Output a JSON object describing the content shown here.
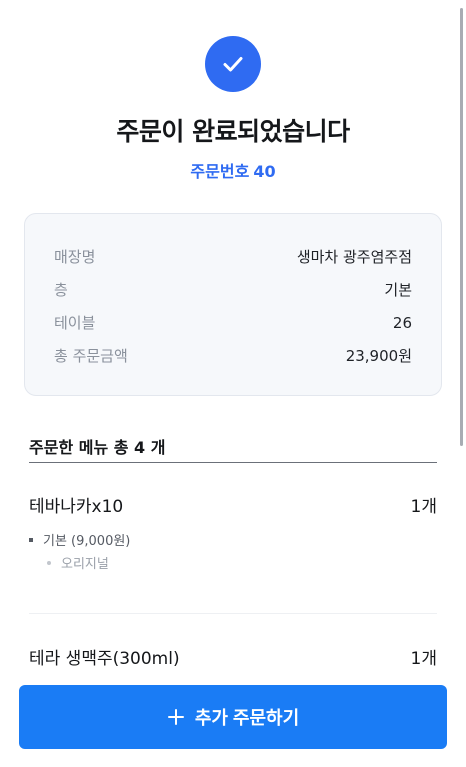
{
  "header": {
    "title": "주문이 완료되었습니다",
    "order_number_label": "주문번호",
    "order_number": "40"
  },
  "info": {
    "rows": [
      {
        "label": "매장명",
        "value": "생마차 광주염주점"
      },
      {
        "label": "층",
        "value": "기본"
      },
      {
        "label": "테이블",
        "value": "26"
      },
      {
        "label": "총 주문금액",
        "value": "23,900원"
      }
    ]
  },
  "menu": {
    "title": "주문한 메뉴 총 4 개",
    "items": [
      {
        "name": "테바나카x10",
        "qty": "1개",
        "option": "기본 (9,000원)",
        "sub_option": "오리지널"
      },
      {
        "name": "테라 생맥주(300ml)",
        "qty": "1개"
      }
    ]
  },
  "actions": {
    "add_order_label": "추가 주문하기"
  },
  "colors": {
    "accent": "#2f6bf2",
    "button": "#1a7cf5"
  },
  "icons": {
    "success": "check-icon",
    "add": "plus-icon"
  }
}
